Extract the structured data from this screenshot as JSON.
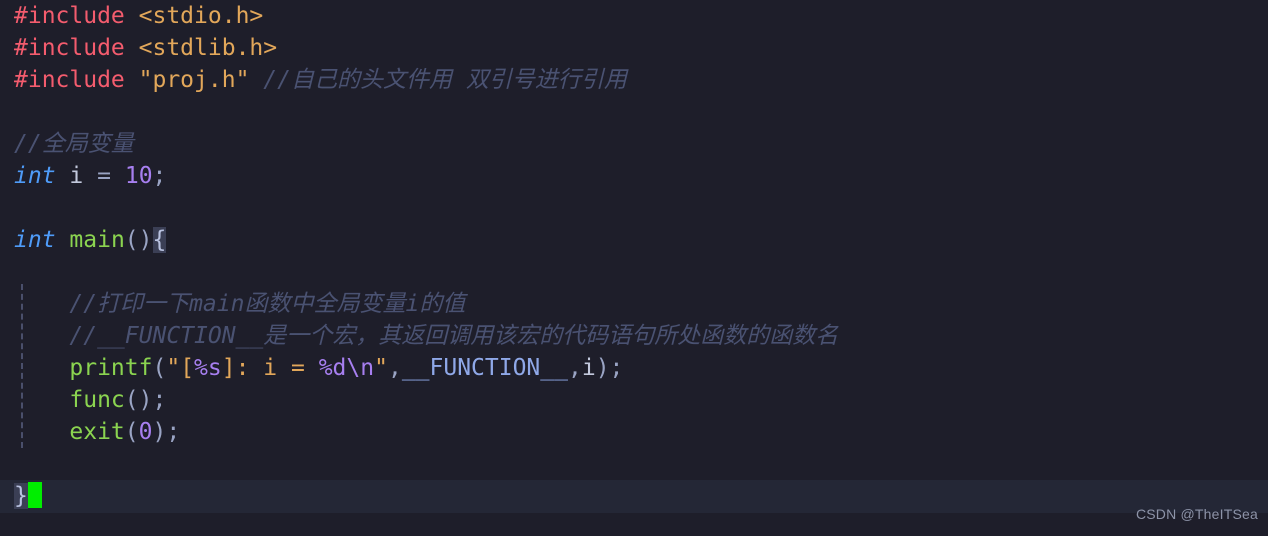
{
  "editor": {
    "theme": "dark-navy",
    "background_color": "#1e1e2a",
    "current_line_color": "#242736",
    "language": "C",
    "cursor_color": "#00ee00",
    "colors": {
      "preprocessor": "#f45c6e",
      "header": "#e2a75a",
      "comment": "#4a5272",
      "keyword": "#4f9cf9",
      "function": "#8bd450",
      "number": "#a77ff0",
      "punctuation": "#9aa4c4",
      "variable": "#c3c9dd",
      "macro": "#8fa8e8",
      "string": "#e2a75a",
      "format_specifier": "#a77ff0",
      "brace": "#b9c2e0",
      "bracket_match_bg": "#3b3f55",
      "indent_guide": "#4a4f6b"
    }
  },
  "code": {
    "lines": [
      {
        "n": 1,
        "tokens": [
          {
            "t": "#include",
            "c": "pre"
          },
          {
            "t": " ",
            "c": "plain"
          },
          {
            "t": "<stdio.h>",
            "c": "hdr"
          }
        ]
      },
      {
        "n": 2,
        "tokens": [
          {
            "t": "#include",
            "c": "pre"
          },
          {
            "t": " ",
            "c": "plain"
          },
          {
            "t": "<stdlib.h>",
            "c": "hdr"
          }
        ]
      },
      {
        "n": 3,
        "tokens": [
          {
            "t": "#include",
            "c": "pre"
          },
          {
            "t": " ",
            "c": "plain"
          },
          {
            "t": "\"proj.h\"",
            "c": "hdr"
          },
          {
            "t": " ",
            "c": "plain"
          },
          {
            "t": "//自己的头文件用 双引号进行引用",
            "c": "cmt"
          }
        ]
      },
      {
        "n": 4,
        "tokens": []
      },
      {
        "n": 5,
        "tokens": [
          {
            "t": "//全局变量",
            "c": "cmt"
          }
        ]
      },
      {
        "n": 6,
        "tokens": [
          {
            "t": "int",
            "c": "kw"
          },
          {
            "t": " ",
            "c": "plain"
          },
          {
            "t": "i",
            "c": "var"
          },
          {
            "t": " ",
            "c": "plain"
          },
          {
            "t": "=",
            "c": "punc"
          },
          {
            "t": " ",
            "c": "plain"
          },
          {
            "t": "10",
            "c": "num"
          },
          {
            "t": ";",
            "c": "punc"
          }
        ]
      },
      {
        "n": 7,
        "tokens": []
      },
      {
        "n": 8,
        "tokens": [
          {
            "t": "int",
            "c": "kw"
          },
          {
            "t": " ",
            "c": "plain"
          },
          {
            "t": "main",
            "c": "fn"
          },
          {
            "t": "()",
            "c": "punc"
          },
          {
            "t": "{",
            "c": "brc-hl"
          }
        ]
      },
      {
        "n": 9,
        "tokens": []
      },
      {
        "n": 10,
        "tokens": [
          {
            "t": "    ",
            "c": "plain"
          },
          {
            "t": "//打印一下main函数中全局变量i的值",
            "c": "cmt"
          }
        ]
      },
      {
        "n": 11,
        "tokens": [
          {
            "t": "    ",
            "c": "plain"
          },
          {
            "t": "//__FUNCTION__是一个宏，其返回调用该宏的代码语句所处函数的函数名",
            "c": "cmt"
          }
        ]
      },
      {
        "n": 12,
        "tokens": [
          {
            "t": "    ",
            "c": "plain"
          },
          {
            "t": "printf",
            "c": "fn"
          },
          {
            "t": "(",
            "c": "punc"
          },
          {
            "t": "\"[",
            "c": "str"
          },
          {
            "t": "%s",
            "c": "fmt"
          },
          {
            "t": "]: i = ",
            "c": "str"
          },
          {
            "t": "%d",
            "c": "fmt"
          },
          {
            "t": "\\n",
            "c": "fmt"
          },
          {
            "t": "\"",
            "c": "str"
          },
          {
            "t": ",",
            "c": "punc"
          },
          {
            "t": "__FUNCTION__",
            "c": "macro"
          },
          {
            "t": ",",
            "c": "punc"
          },
          {
            "t": "i",
            "c": "var"
          },
          {
            "t": ");",
            "c": "punc"
          }
        ]
      },
      {
        "n": 13,
        "tokens": [
          {
            "t": "    ",
            "c": "plain"
          },
          {
            "t": "func",
            "c": "fn"
          },
          {
            "t": "();",
            "c": "punc"
          }
        ]
      },
      {
        "n": 14,
        "tokens": [
          {
            "t": "    ",
            "c": "plain"
          },
          {
            "t": "exit",
            "c": "fn"
          },
          {
            "t": "(",
            "c": "punc"
          },
          {
            "t": "0",
            "c": "num"
          },
          {
            "t": ");",
            "c": "punc"
          }
        ]
      },
      {
        "n": 15,
        "tokens": []
      },
      {
        "n": 16,
        "current": true,
        "cursor_after": true,
        "tokens": [
          {
            "t": "}",
            "c": "brc-hl"
          }
        ]
      }
    ]
  },
  "watermark": {
    "text": "CSDN @TheITSea"
  }
}
